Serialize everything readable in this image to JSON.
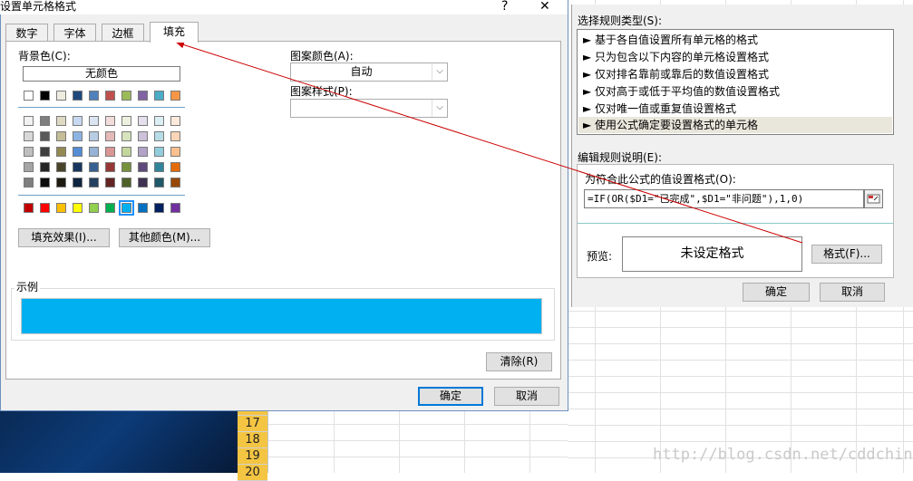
{
  "dialog": {
    "title": "设置单元格格式",
    "help_label": "?",
    "close_label": "✕",
    "tabs": [
      {
        "label": "数字"
      },
      {
        "label": "字体"
      },
      {
        "label": "边框"
      },
      {
        "label": "填充"
      }
    ],
    "active_tab": "填充",
    "fill": {
      "bg_color_label": "背景色(C):",
      "no_color_label": "无颜色",
      "pattern_color_label": "图案颜色(A):",
      "pattern_color_value": "自动",
      "pattern_style_label": "图案样式(P):",
      "pattern_style_value": "",
      "fill_effects_button": "填充效果(I)...",
      "more_colors_button": "其他颜色(M)...",
      "sample_label": "示例",
      "sample_color": "#00b0f0",
      "clear_button": "清除(R)",
      "theme_row": [
        "#ffffff",
        "#000000",
        "#eeece1",
        "#1f497d",
        "#4f81bd",
        "#c0504d",
        "#9bbb59",
        "#8064a2",
        "#4bacc6",
        "#f79646"
      ],
      "tint_rows": [
        [
          "#f2f2f2",
          "#7f7f7f",
          "#ddd9c3",
          "#c6d9f0",
          "#dbe5f1",
          "#f2dcdb",
          "#ebf1dd",
          "#e5e0ec",
          "#dbeef3",
          "#fdeada"
        ],
        [
          "#d8d8d8",
          "#595959",
          "#c4bd97",
          "#8db3e2",
          "#b8cce4",
          "#e5b9b7",
          "#d7e3bc",
          "#ccc1d9",
          "#b7dde8",
          "#fbd5b5"
        ],
        [
          "#bfbfbf",
          "#3f3f3f",
          "#938953",
          "#548dd4",
          "#95b3d7",
          "#d99694",
          "#c3d69b",
          "#b2a2c7",
          "#92cddc",
          "#fac08f"
        ],
        [
          "#a5a5a5",
          "#262626",
          "#494429",
          "#17365d",
          "#366092",
          "#953734",
          "#76923c",
          "#5f497a",
          "#31859b",
          "#e36c09"
        ],
        [
          "#7f7f7f",
          "#0c0c0c",
          "#1d1b10",
          "#0f243e",
          "#244061",
          "#632423",
          "#4f6128",
          "#3f3151",
          "#205867",
          "#974806"
        ]
      ],
      "standard_row": [
        "#c00000",
        "#ff0000",
        "#ffc000",
        "#ffff00",
        "#92d050",
        "#00b050",
        "#00b0f0",
        "#0070c0",
        "#002060",
        "#7030a0"
      ],
      "selected_color": "#00b0f0"
    },
    "ok_button": "确定",
    "cancel_button": "取消"
  },
  "rule_dialog": {
    "select_rule_type_label": "选择规则类型(S):",
    "rule_types": [
      {
        "label": "► 基于各自值设置所有单元格的格式"
      },
      {
        "label": "► 只为包含以下内容的单元格设置格式"
      },
      {
        "label": "► 仅对排名靠前或靠后的数值设置格式"
      },
      {
        "label": "► 仅对高于或低于平均值的数值设置格式"
      },
      {
        "label": "► 仅对唯一值或重复值设置格式"
      },
      {
        "label": "► 使用公式确定要设置格式的单元格"
      }
    ],
    "edit_rule_label": "编辑规则说明(E):",
    "formula_label": "为符合此公式的值设置格式(O):",
    "formula_value": "=IF(OR($D1=\"已完成\",$D1=\"非问题\"),1,0)",
    "preview_label": "预览:",
    "preview_text": "未设定格式",
    "format_button": "格式(F)...",
    "ok_button": "确定",
    "cancel_button": "取消"
  },
  "sheet": {
    "row_numbers": [
      "17",
      "18",
      "19",
      "20"
    ],
    "watermark": "http://blog.csdn.net/cddchina"
  },
  "colors": {
    "annotation_arrow": "#cc0000",
    "dialog_border": "#6d8fbf"
  }
}
